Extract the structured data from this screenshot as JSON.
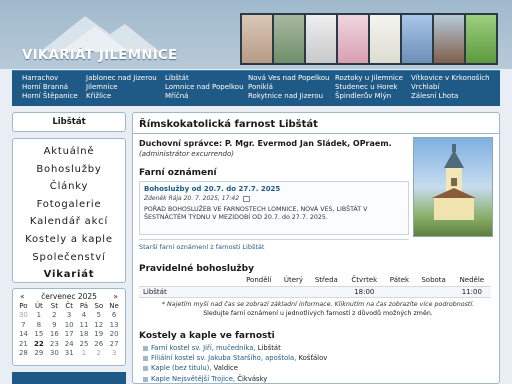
{
  "site": {
    "title": "VIKARIÁT JILEMNICE"
  },
  "topnav": {
    "columns": [
      [
        "Harrachov",
        "Horní Branná",
        "Horní Štěpanice"
      ],
      [
        "Jablonec nad Jizerou",
        "Jilemnice",
        "Křižlice"
      ],
      [
        "Libštát",
        "Lomnice nad Popelkou",
        "Mříčná"
      ],
      [
        "Nová Ves nad Popelkou",
        "Poniklá",
        "Rokytnice nad Jizerou"
      ],
      [
        "Roztoky u Jilemnice",
        "Studenec u Horek",
        "Špindlerův Mlýn"
      ],
      [
        "Vítkovice v Krkonoších",
        "Vrchlabí",
        "Zálesní Lhota"
      ]
    ]
  },
  "left": {
    "current_parish": "Libštát",
    "menu": [
      "Aktuálně",
      "Bohoslužby",
      "Články",
      "Fotogalerie",
      "Kalendář akcí",
      "Kostely a kaple",
      "Společenství",
      "Vikariát"
    ],
    "active_menu": "Vikariát"
  },
  "calendar": {
    "prev": "«",
    "next": "»",
    "month": "červenec 2025",
    "days": [
      "Po",
      "Út",
      "St",
      "Čt",
      "Pá",
      "So",
      "Ne"
    ],
    "weeks": [
      [
        "30",
        "1",
        "2",
        "3",
        "4",
        "5",
        "6"
      ],
      [
        "7",
        "8",
        "9",
        "10",
        "11",
        "12",
        "13"
      ],
      [
        "14",
        "15",
        "16",
        "17",
        "18",
        "19",
        "20"
      ],
      [
        "21",
        "22",
        "23",
        "24",
        "25",
        "26",
        "27"
      ],
      [
        "28",
        "29",
        "30",
        "31",
        "1",
        "2",
        "3"
      ]
    ],
    "today": "22"
  },
  "main": {
    "title": "Římskokatolická farnost Libštát",
    "spravce": "Duchovní správce: P. Mgr. Evermod Jan Sládek, OPraem.",
    "admin_note": "(administrátor excurrendo)",
    "farni_title": "Farní oznámení",
    "notice": {
      "title": "Bohoslužby od 20.7. do 27.7. 2025",
      "meta": "Zdeněk Rája 20. 7. 2025, 17:42",
      "text": "POŘAD BOHOSLUŽEB VE FARNOSTECH LOMNICE, NOVÁ VES, LIBŠTÁT V ŠESTNÁCTÉM TÝDNU V MEZIDOBÍ OD 20.7. do 27.7. 2025."
    },
    "older_link": "Starší farní oznámení z farnosti Libštát",
    "pravidelne_title": "Pravidelné bohoslužby",
    "schedule": {
      "headers": [
        "",
        "Pondělí",
        "Úterý",
        "Středa",
        "Čtvrtek",
        "Pátek",
        "Sobota",
        "Neděle"
      ],
      "rows": [
        [
          "Libštát",
          "",
          "",
          "",
          "18:00",
          "",
          "",
          "11:00"
        ]
      ]
    },
    "note_italic": "* Najetím myši nad čas se zobrazí základní informace. Kliknutím na čas zobrazíte více podrobností.",
    "note_plain": "Sledujte farní oznámení u jednotlivých farností z důvodů možných změn.",
    "kostely_title": "Kostely a kaple ve farnosti",
    "kostely": [
      {
        "type": "Farní kostel sv. Jiří, mučedníka,",
        "place": "Libštát"
      },
      {
        "type": "Filiální kostel sv. Jakuba Staršího, apoštola,",
        "place": "Košťálov"
      },
      {
        "type": "Kaple (bez titulu),",
        "place": "Valdice"
      },
      {
        "type": "Kaple Nejsvětější Trojice,",
        "place": "Čikvásky"
      }
    ]
  },
  "colors": {
    "nav": "#1f5a86",
    "border": "#9fb9cc",
    "link": "#1f5a86"
  }
}
